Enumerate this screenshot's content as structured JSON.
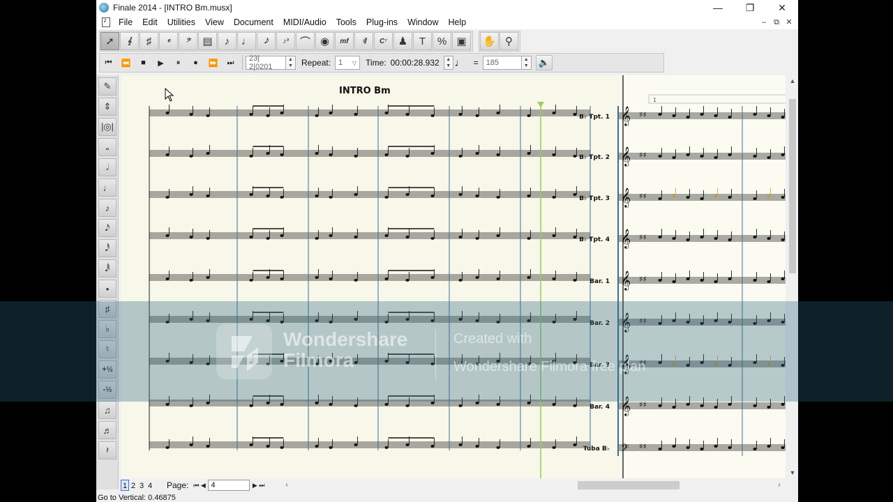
{
  "window": {
    "title": "Finale 2014 - [INTRO Bm.musx]",
    "controls": [
      "—",
      "❐",
      "✕"
    ]
  },
  "menu": [
    "File",
    "Edit",
    "Utilities",
    "View",
    "Document",
    "MIDI/Audio",
    "Tools",
    "Plug-ins",
    "Window",
    "Help"
  ],
  "mdi_controls": [
    "–",
    "⧉",
    "✕"
  ],
  "main_tools": [
    {
      "name": "selection-tool",
      "glyph": "➚",
      "active": true
    },
    {
      "name": "staff-tool",
      "glyph": "𝄞"
    },
    {
      "name": "key-signature-tool",
      "glyph": "♯"
    },
    {
      "name": "time-signature-tool",
      "glyph": "𝄴"
    },
    {
      "name": "clef-tool",
      "glyph": "𝄢"
    },
    {
      "name": "measure-tool",
      "glyph": "▤"
    },
    {
      "name": "simple-entry-tool",
      "glyph": "♪"
    },
    {
      "name": "speedy-entry-tool",
      "glyph": "♩"
    },
    {
      "name": "hyperscribe-tool",
      "glyph": "𝅘𝅥𝅮"
    },
    {
      "name": "tuplet-tool",
      "glyph": "♪³"
    },
    {
      "name": "smart-shape-tool",
      "glyph": "⌒"
    },
    {
      "name": "articulation-tool",
      "glyph": "◉"
    },
    {
      "name": "expression-tool",
      "glyph": "mf"
    },
    {
      "name": "repeat-tool",
      "glyph": "𝄇"
    },
    {
      "name": "chord-tool",
      "glyph": "C⁷"
    },
    {
      "name": "lyrics-tool",
      "glyph": "♟"
    },
    {
      "name": "text-tool",
      "glyph": "T"
    },
    {
      "name": "resize-tool",
      "glyph": "%"
    },
    {
      "name": "page-layout-tool",
      "glyph": "▣"
    }
  ],
  "view_tools": [
    {
      "name": "hand-grabber-tool",
      "glyph": "✋"
    },
    {
      "name": "zoom-tool",
      "glyph": "⚲"
    }
  ],
  "playback": {
    "buttons": [
      {
        "name": "rewind-to-start-button",
        "glyph": "⏮"
      },
      {
        "name": "rewind-button",
        "glyph": "⏪"
      },
      {
        "name": "stop-button",
        "glyph": "■"
      },
      {
        "name": "play-button",
        "glyph": "▶"
      },
      {
        "name": "pause-button",
        "glyph": "⏸"
      },
      {
        "name": "record-button",
        "glyph": "●"
      },
      {
        "name": "fast-forward-button",
        "glyph": "⏩"
      },
      {
        "name": "forward-to-end-button",
        "glyph": "⏭"
      }
    ],
    "counter": "23| 2|0201",
    "repeat_label": "Repeat:",
    "repeat_value": "1",
    "time_label": "Time:",
    "time_value": "00:00:28.932",
    "tempo_equals": "=",
    "tempo_value": "185"
  },
  "palette": [
    "✎",
    "⇕",
    "|◎|",
    "𝅝",
    "𝅗𝅥",
    "♩",
    "♪",
    "𝅘𝅥𝅯",
    "𝅘𝅥𝅰",
    "𝅘𝅥𝅱",
    "•",
    "♯",
    "♭",
    "♮",
    "+½",
    "-½",
    "♫",
    "♬",
    "𝄽"
  ],
  "score": {
    "title": "INTRO Bm",
    "measure_number": "1",
    "staff_names": [
      "B♭ Tpt. 1",
      "B♭ Tpt. 2",
      "B♭ Tpt. 3",
      "B♭ Tpt. 4",
      "Bar. 1",
      "Bar. 2",
      "Bar. 3",
      "Bar. 4",
      "Tuba B♭"
    ],
    "colors": {
      "paper": "#fbfbf1",
      "barline_blue": "#3d6f99",
      "cursor_green": "#9ccc5a",
      "highlight_note": "#c9a642"
    }
  },
  "navigation": {
    "pages": [
      "1",
      "2",
      "3",
      "4"
    ],
    "page_label": "Page:",
    "page_value": "4"
  },
  "status": "Go to Vertical: 0.46875",
  "watermark": {
    "brand_line1": "Wondershare",
    "brand_line2": "Filmora",
    "created": "Created with",
    "plan": "Wondershare Filmora free plan"
  }
}
